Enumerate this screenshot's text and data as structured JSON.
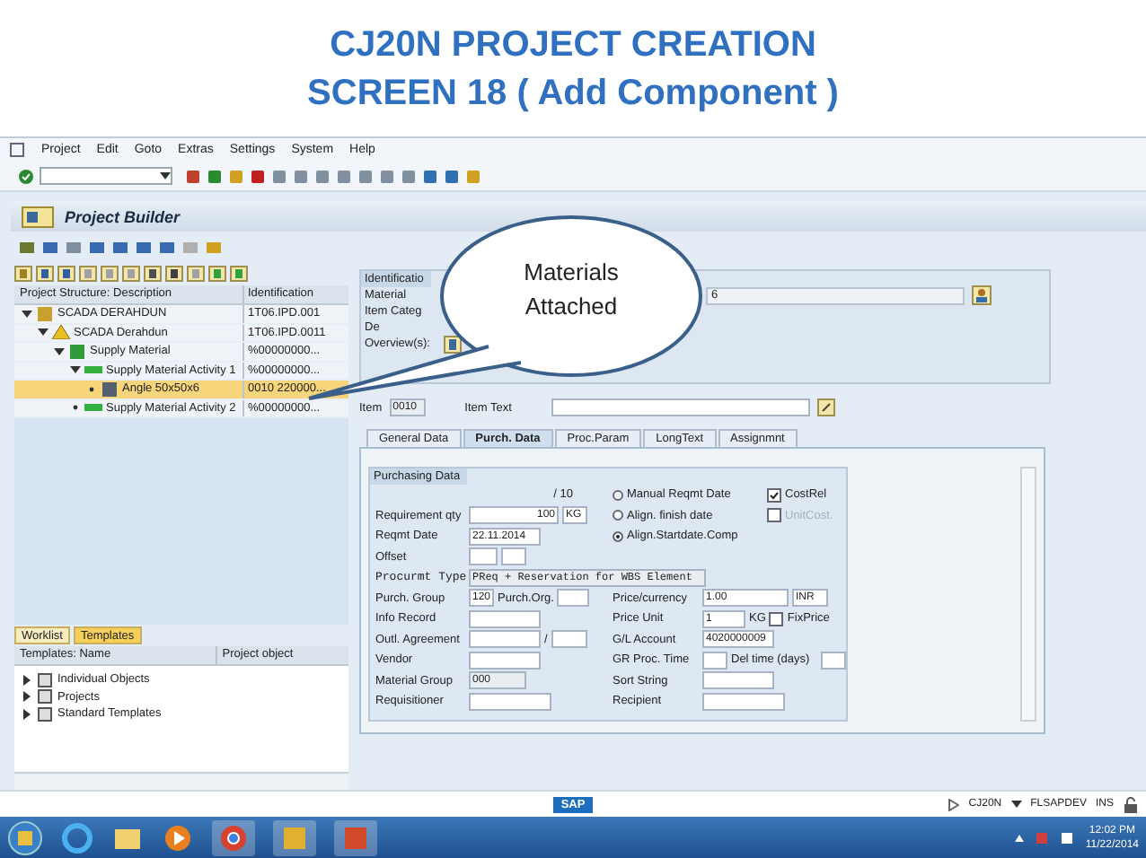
{
  "slide_title": [
    "CJ20N PROJECT CREATION",
    "SCREEN 18 ( Add Component )"
  ],
  "menu": [
    "Project",
    "Edit",
    "Goto",
    "Extras",
    "Settings",
    "System",
    "Help"
  ],
  "screen_title": "Project Builder",
  "structure_tree": {
    "columns": [
      "Project Structure: Description",
      "Identification"
    ],
    "items": [
      {
        "label": "SCADA DERAHDUN",
        "identification": "1T06.IPD.001",
        "kind": "project",
        "expanded": true,
        "selected": false,
        "children": [
          {
            "label": "SCADA Derahdun",
            "identification": "1T06.IPD.0011",
            "kind": "wbs",
            "expanded": true,
            "selected": false,
            "children": [
              {
                "label": "Supply Material",
                "identification": "%00000000...",
                "kind": "network",
                "expanded": true,
                "selected": false,
                "children": [
                  {
                    "label": "Supply Material Activity 1",
                    "identification": "%00000000...",
                    "kind": "activity",
                    "expanded": true,
                    "selected": false,
                    "children": [
                      {
                        "label": "Angle 50x50x6",
                        "identification": "0010 220000...",
                        "kind": "component",
                        "expanded": false,
                        "selected": true
                      }
                    ]
                  },
                  {
                    "label": "Supply Material Activity 2",
                    "identification": "%00000000...",
                    "kind": "activity",
                    "expanded": false,
                    "selected": false
                  }
                ]
              }
            ]
          }
        ]
      }
    ]
  },
  "lower_tabs": [
    {
      "label": "Worklist",
      "selected": false
    },
    {
      "label": "Templates",
      "selected": true
    }
  ],
  "templates_tree": {
    "columns": [
      "Templates: Name",
      "Project object"
    ],
    "items": [
      {
        "label": "Individual Objects",
        "expanded": false
      },
      {
        "label": "Projects",
        "expanded": false
      },
      {
        "label": "Standard Templates",
        "expanded": false
      }
    ]
  },
  "identification": {
    "title": "Identificatio",
    "fields": [
      {
        "label": "Material",
        "kind": "input",
        "value": "6"
      },
      {
        "label": "Item Categ",
        "kind": "text"
      },
      {
        "label": "De",
        "kind": "text"
      },
      {
        "label": "Overview(s):",
        "kind": "button"
      }
    ]
  },
  "item": {
    "label": "Item",
    "value": "0010"
  },
  "item_text": {
    "label": "Item Text"
  },
  "detail_tabs": [
    {
      "label": "General Data",
      "selected": false
    },
    {
      "label": "Purch. Data",
      "selected": true
    },
    {
      "label": "Proc.Param",
      "selected": false
    },
    {
      "label": "LongText",
      "selected": false
    },
    {
      "label": "Assignmnt",
      "selected": false
    }
  ],
  "purchasing": {
    "title": "Purchasing Data",
    "counter": "/ 10",
    "radios": [
      {
        "label": "Manual Reqmt Date",
        "selected": false
      },
      {
        "label": "Align. finish date",
        "selected": false
      },
      {
        "label": "Align.Startdate.Comp",
        "selected": true
      }
    ],
    "checks": [
      {
        "label": "CostRel",
        "checked": true,
        "disabled": false
      },
      {
        "label": "UnitCost.",
        "checked": false,
        "disabled": true
      }
    ],
    "requirement_qty": {
      "label": "Requirement qty",
      "value": "100",
      "unit": "KG"
    },
    "reqmt_date": {
      "label": "Reqmt Date",
      "value": "22.11.2014"
    },
    "offset": {
      "label": "Offset"
    },
    "procurement_type": {
      "label": "Procurmt Type",
      "value": "PReq + Reservation for WBS Element"
    },
    "purch_group": {
      "label": "Purch. Group",
      "value": "120"
    },
    "purch_org": {
      "label": "Purch.Org."
    },
    "info_record": {
      "label": "Info Record"
    },
    "outline_agreement": {
      "label": "Outl. Agreement",
      "separator": "/"
    },
    "vendor": {
      "label": "Vendor"
    },
    "material_group": {
      "label": "Material Group",
      "value": "000",
      "disabled": true
    },
    "requisitioner": {
      "label": "Requisitioner"
    },
    "price": {
      "label": "Price/currency",
      "value": "1.00",
      "currency": "INR"
    },
    "price_unit": {
      "label": "Price Unit",
      "value": "1",
      "unit": "KG"
    },
    "fix_price": {
      "label": "FixPrice",
      "checked": false
    },
    "gl_account": {
      "label": "G/L Account",
      "value": "4020000009"
    },
    "gr_time": {
      "label": "GR Proc. Time"
    },
    "del_time": {
      "label": "Del time (days)"
    },
    "sort_string": {
      "label": "Sort String"
    },
    "recipient": {
      "label": "Recipient"
    }
  },
  "callout": "Materials Attached",
  "status_bar": {
    "logo": "SAP",
    "transaction": "CJ20N",
    "server": "FLSAPDEV",
    "mode": "INS"
  },
  "taskbar": {
    "time": "12:02 PM",
    "date": "11/22/2014"
  }
}
